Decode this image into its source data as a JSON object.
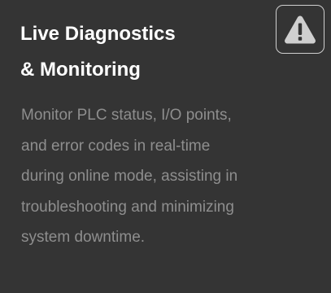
{
  "card": {
    "title_lines": [
      "Live Diagnostics",
      "& Monitoring"
    ],
    "icon": "warning-triangle-icon",
    "description_lines": [
      "Monitor PLC status, I/O points,",
      "and error codes in real-time",
      "during online mode, assisting in",
      "troubleshooting and minimizing",
      "system downtime."
    ]
  },
  "colors": {
    "background": "#343434",
    "title": "#ffffff",
    "description": "#8e8e8e",
    "icon": "#cfcfcf"
  }
}
